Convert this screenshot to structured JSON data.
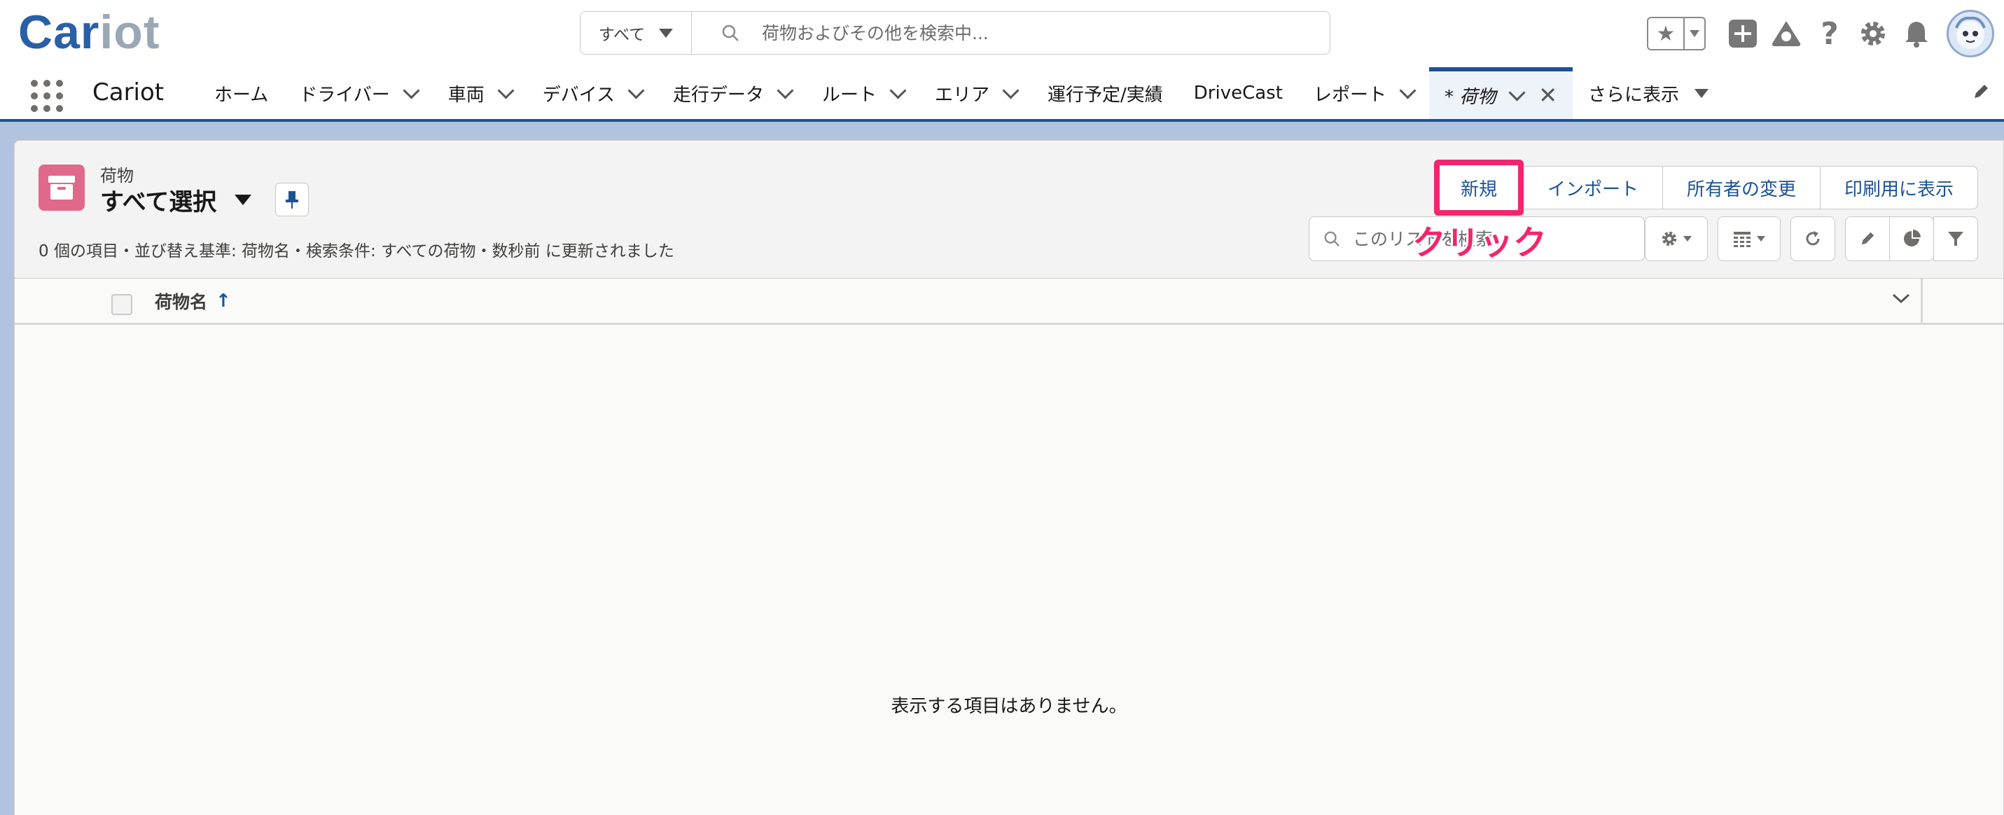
{
  "header": {
    "logo_part1": "Car",
    "logo_part2": "iot",
    "search_scope": "すべて",
    "search_placeholder": "荷物およびその他を検索中...",
    "icons": [
      "favorites-star-icon",
      "add-icon",
      "trailhead-icon",
      "help-icon",
      "setup-gear-icon",
      "notifications-bell-icon",
      "user-avatar"
    ]
  },
  "nav": {
    "app_name": "Cariot",
    "items": [
      {
        "label": "ホーム",
        "dropdown": false
      },
      {
        "label": "ドライバー",
        "dropdown": true
      },
      {
        "label": "車両",
        "dropdown": true
      },
      {
        "label": "デバイス",
        "dropdown": true
      },
      {
        "label": "走行データ",
        "dropdown": true
      },
      {
        "label": "ルート",
        "dropdown": true
      },
      {
        "label": "エリア",
        "dropdown": true
      },
      {
        "label": "運行予定/実績",
        "dropdown": false
      },
      {
        "label": "DriveCast",
        "dropdown": false
      },
      {
        "label": "レポート",
        "dropdown": true
      }
    ],
    "active_tab": "* 荷物",
    "more_label": "さらに表示"
  },
  "list": {
    "object_label": "荷物",
    "view_name": "すべて選択",
    "meta": "0 個の項目・並び替え基準: 荷物名・検索条件: すべての荷物・数秒前 に更新されました",
    "buttons": {
      "new": "新規",
      "import": "インポート",
      "change_owner": "所有者の変更",
      "print": "印刷用に表示"
    },
    "search_placeholder": "このリストを検索...",
    "callout": "クリック",
    "column_header": "荷物名",
    "empty_message": "表示する項目はありません。"
  },
  "colors": {
    "brand_blue": "#1b5297",
    "object_pink": "#e0698b",
    "highlight": "#f4246e"
  }
}
